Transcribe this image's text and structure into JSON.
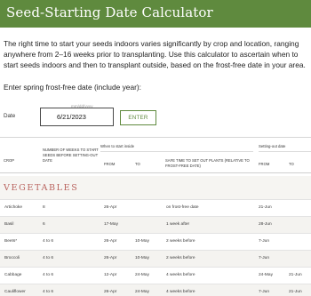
{
  "header": {
    "title": "Seed-Starting Date Calculator"
  },
  "intro": {
    "paragraph": "The right time to start your seeds indoors varies significantly by crop and location, ranging anywhere from 2–16 weeks prior to transplanting. Use this calculator to ascertain when to start seeds indoors and then to transplant outside, based on the frost-free date in your area.",
    "prompt": "Enter spring frost-free date (include year):"
  },
  "form": {
    "date_label": "Date",
    "date_placeholder": "mm/dd/yyyy",
    "date_value": "6/21/2023",
    "enter_label": "ENTER"
  },
  "table": {
    "group_inside": "When to start inside",
    "group_setout": "Setting-out date",
    "headers": {
      "crop": "CROP",
      "weeks": "NUMBER OF WEEKS TO START SEEDS BEFORE SETTING-OUT DATE",
      "from": "FROM",
      "to": "TO",
      "safe": "SAFE TIME TO SET OUT PLANTS (RELATIVE TO FROST-FREE DATE)",
      "from2": "FROM",
      "to2": "TO"
    },
    "section": "VEGETABLES",
    "rows": [
      {
        "crop": "Artichoke",
        "weeks": "8",
        "from": "26-Apr",
        "to": "",
        "safe": "on frost-free date",
        "from2": "21-Jun",
        "to2": ""
      },
      {
        "crop": "Basil",
        "weeks": "6",
        "from": "17-May",
        "to": "",
        "safe": "1 week after",
        "from2": "28-Jun",
        "to2": ""
      },
      {
        "crop": "Beets*",
        "weeks": "4 to 6",
        "from": "26-Apr",
        "to": "10-May",
        "safe": "2 weeks before",
        "from2": "7-Jun",
        "to2": ""
      },
      {
        "crop": "Broccoli",
        "weeks": "4 to 6",
        "from": "26-Apr",
        "to": "10-May",
        "safe": "2 weeks before",
        "from2": "7-Jun",
        "to2": ""
      },
      {
        "crop": "Cabbage",
        "weeks": "4 to 6",
        "from": "12-Apr",
        "to": "24-May",
        "safe": "4 weeks before",
        "from2": "24-May",
        "to2": "21-Jun"
      },
      {
        "crop": "Cauliflower",
        "weeks": "4 to 6",
        "from": "26-Apr",
        "to": "24-May",
        "safe": "4 weeks before",
        "from2": "7-Jun",
        "to2": "21-Jun"
      }
    ]
  },
  "colors": {
    "brand_green": "#5f8a3e",
    "section_red": "#b9635e"
  }
}
